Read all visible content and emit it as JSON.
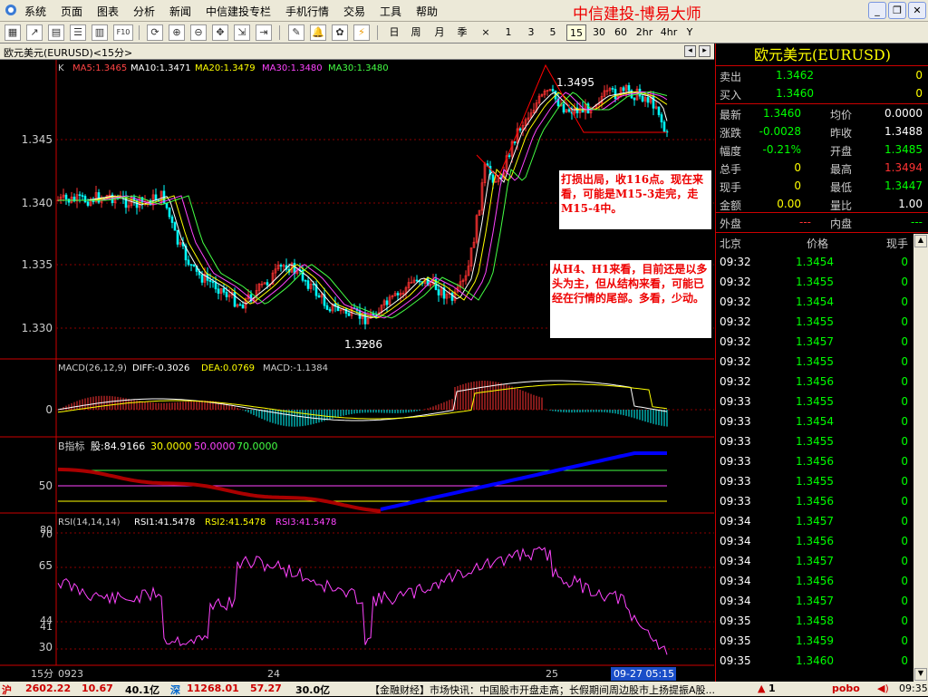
{
  "menu": [
    "系统",
    "页面",
    "图表",
    "分析",
    "新闻",
    "中信建投专栏",
    "手机行情",
    "交易",
    "工具",
    "帮助"
  ],
  "brand": "中信建投-博易大师",
  "window_buttons": [
    "_",
    "❐",
    "✕"
  ],
  "periods": [
    "日",
    "周",
    "月",
    "季",
    "×",
    "1",
    "3",
    "5",
    "15",
    "30",
    "60",
    "2hr",
    "4hr",
    "Y"
  ],
  "active_period": "15",
  "chart_title": "欧元美元(EURUSD)<15分>",
  "main": {
    "label": "K",
    "ma": [
      {
        "text": "MA5:1.3465",
        "color": "#ff4444"
      },
      {
        "text": "MA10:1.3471",
        "color": "#ffffff"
      },
      {
        "text": "MA20:1.3479",
        "color": "#ffff00"
      },
      {
        "text": "MA30:1.3480",
        "color": "#ff44ff"
      },
      {
        "text": "MA30:1.3480",
        "color": "#44ff44"
      }
    ],
    "y_ticks": [
      "1.345",
      "1.340",
      "1.335",
      "1.330"
    ],
    "high_label": "1.3495",
    "low_label": "1.3286",
    "note1": "打损出局，收116点。现在来看，可能是M15-3走完，走M15-4中。",
    "note2": "从H4、H1来看，目前还是以多头为主，但从结构来看，可能已经在行情的尾部。多看，少动。"
  },
  "macd": {
    "label": "MACD(26,12,9)",
    "diff": "DIFF:-0.3026",
    "dea": "DEA:0.0769",
    "macd": "MACD:-1.1384",
    "zero_tick": "0"
  },
  "bind": {
    "label": "B指标",
    "value": "股:84.9166",
    "l30": "30.0000",
    "l50": "50.0000",
    "l70": "70.0000",
    "tick": "50"
  },
  "rsi": {
    "label": "RSI(14,14,14)",
    "rsi1": "RSI1:41.5478",
    "rsi2": "RSI2:41.5478",
    "rsi3": "RSI3:41.5478",
    "ticks": [
      "80",
      "70",
      "65",
      "44",
      "41",
      "30"
    ]
  },
  "x_axis": {
    "period_label": "15分",
    "labels": [
      "0923",
      "24",
      "25"
    ],
    "cursor": "09-27 05:15"
  },
  "panel": {
    "title": "欧元美元(EURUSD)",
    "sell_label": "卖出",
    "sell": "1.3462",
    "sell_qty": "0",
    "buy_label": "买入",
    "buy": "1.3460",
    "buy_qty": "0",
    "quote_left": [
      {
        "label": "最新",
        "value": "1.3460",
        "color": "gr"
      },
      {
        "label": "涨跌",
        "value": "-0.0028",
        "color": "gr"
      },
      {
        "label": "幅度",
        "value": "-0.21%",
        "color": "gr"
      },
      {
        "label": "总手",
        "value": "0",
        "color": "yl"
      },
      {
        "label": "现手",
        "value": "0",
        "color": "yl"
      },
      {
        "label": "金额",
        "value": "0.00",
        "color": "yl"
      }
    ],
    "quote_right": [
      {
        "label": "均价",
        "value": "0.0000",
        "color": "wh"
      },
      {
        "label": "昨收",
        "value": "1.3488",
        "color": "wh"
      },
      {
        "label": "开盘",
        "value": "1.3485",
        "color": "gr"
      },
      {
        "label": "最高",
        "value": "1.3494",
        "color": "rd"
      },
      {
        "label": "最低",
        "value": "1.3447",
        "color": "gr"
      },
      {
        "label": "量比",
        "value": "1.00",
        "color": "wh"
      }
    ],
    "outer_label": "外盘",
    "outer": "---",
    "inner_label": "内盘",
    "inner": "---",
    "tick_headers": [
      "北京",
      "价格",
      "现手"
    ],
    "ticks": [
      {
        "t": "09:32",
        "p": "1.3454",
        "v": "0"
      },
      {
        "t": "09:32",
        "p": "1.3455",
        "v": "0"
      },
      {
        "t": "09:32",
        "p": "1.3454",
        "v": "0"
      },
      {
        "t": "09:32",
        "p": "1.3455",
        "v": "0"
      },
      {
        "t": "09:32",
        "p": "1.3457",
        "v": "0"
      },
      {
        "t": "09:32",
        "p": "1.3455",
        "v": "0"
      },
      {
        "t": "09:32",
        "p": "1.3456",
        "v": "0"
      },
      {
        "t": "09:33",
        "p": "1.3455",
        "v": "0"
      },
      {
        "t": "09:33",
        "p": "1.3454",
        "v": "0"
      },
      {
        "t": "09:33",
        "p": "1.3455",
        "v": "0"
      },
      {
        "t": "09:33",
        "p": "1.3456",
        "v": "0"
      },
      {
        "t": "09:33",
        "p": "1.3455",
        "v": "0"
      },
      {
        "t": "09:33",
        "p": "1.3456",
        "v": "0"
      },
      {
        "t": "09:34",
        "p": "1.3457",
        "v": "0"
      },
      {
        "t": "09:34",
        "p": "1.3456",
        "v": "0"
      },
      {
        "t": "09:34",
        "p": "1.3457",
        "v": "0"
      },
      {
        "t": "09:34",
        "p": "1.3456",
        "v": "0"
      },
      {
        "t": "09:34",
        "p": "1.3457",
        "v": "0"
      },
      {
        "t": "09:35",
        "p": "1.3458",
        "v": "0"
      },
      {
        "t": "09:35",
        "p": "1.3459",
        "v": "0"
      },
      {
        "t": "09:35",
        "p": "1.3460",
        "v": "0"
      }
    ]
  },
  "status": {
    "sh_label": "沪",
    "sh_index": "2602.22",
    "sh_change": "10.67",
    "sh_amount": "40.1亿",
    "sz_label": "深",
    "sz_index": "11268.01",
    "sz_change": "57.27",
    "sz_amount": "30.0亿",
    "news": "【金融财经】市场快讯：中国股市开盘走高；长假期间周边股市上扬提振A股...",
    "alert": "1",
    "pobo": "pobo",
    "time": "09:35"
  },
  "colors": {
    "up": "#ff3333",
    "down": "#00ffff",
    "grid": "#8b0000",
    "accent_red": "#ff0000"
  }
}
